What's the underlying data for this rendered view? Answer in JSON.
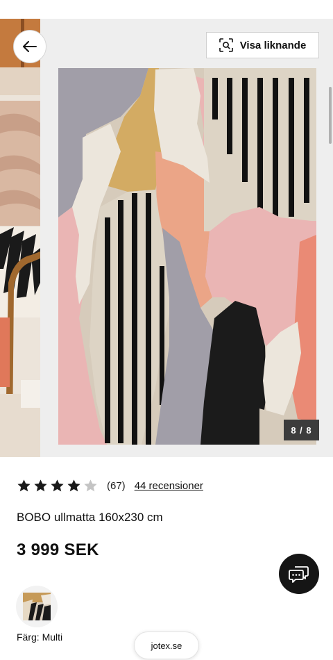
{
  "gallery": {
    "counter": "8 / 8",
    "similar_label": "Visa liknande"
  },
  "product": {
    "rating_value": 4,
    "rating_max": 5,
    "rating_count": "(67)",
    "reviews_link": "44 recensioner",
    "title": "BOBO ullmatta 160x230 cm",
    "price": "3 999 SEK",
    "color_label": "Färg: Multi"
  },
  "browser": {
    "url": "jotex.se"
  },
  "icons": {
    "back": "arrow-left-icon",
    "similar": "visual-search-icon",
    "chat": "chat-icon",
    "star_filled": "star-filled-icon",
    "star_empty": "star-empty-icon"
  },
  "colors": {
    "star_filled": "#1a1a1a",
    "star_empty": "#c4c4c4",
    "counter_bg": "#3c3c3c",
    "chat_bg": "#151515",
    "gallery_bg": "#eeeeee"
  }
}
